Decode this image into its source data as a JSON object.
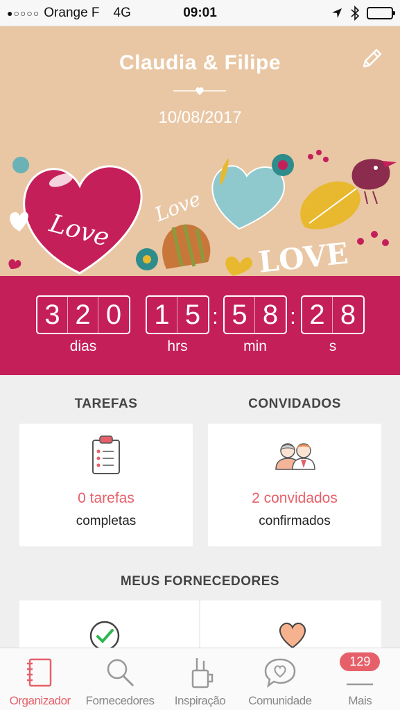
{
  "status_bar": {
    "signal": "●○○○○",
    "carrier": "Orange F",
    "network": "4G",
    "time": "09:01"
  },
  "header": {
    "couple_names": "Claudia & Filipe",
    "wedding_date": "10/08/2017",
    "art_words": [
      "Love",
      "Love",
      "LOVE"
    ]
  },
  "countdown": {
    "days": {
      "digits": [
        "3",
        "2",
        "0"
      ],
      "label": "dias"
    },
    "hours": {
      "digits": [
        "1",
        "5"
      ],
      "label": "hrs"
    },
    "minutes": {
      "digits": [
        "5",
        "8"
      ],
      "label": "min"
    },
    "seconds": {
      "digits": [
        "2",
        "8"
      ],
      "label": "s"
    },
    "separator": ":"
  },
  "tasks": {
    "title": "TAREFAS",
    "count_text": "0 tarefas",
    "sub_text": "completas"
  },
  "guests": {
    "title": "CONVIDADOS",
    "count_text": "2 convidados",
    "sub_text": "confirmados"
  },
  "vendors": {
    "title": "MEUS FORNECEDORES"
  },
  "tabbar": {
    "tabs": [
      {
        "label": "Organizador",
        "icon": "notebook-icon",
        "active": true
      },
      {
        "label": "Fornecedores",
        "icon": "search-icon"
      },
      {
        "label": "Inspiração",
        "icon": "tools-icon"
      },
      {
        "label": "Comunidade",
        "icon": "chat-heart-icon"
      },
      {
        "label": "Mais",
        "icon": "menu-icon",
        "badge": "129"
      }
    ]
  },
  "colors": {
    "accent": "#c51f5a",
    "highlight": "#e6606a",
    "banner": "#e9c7a4"
  }
}
